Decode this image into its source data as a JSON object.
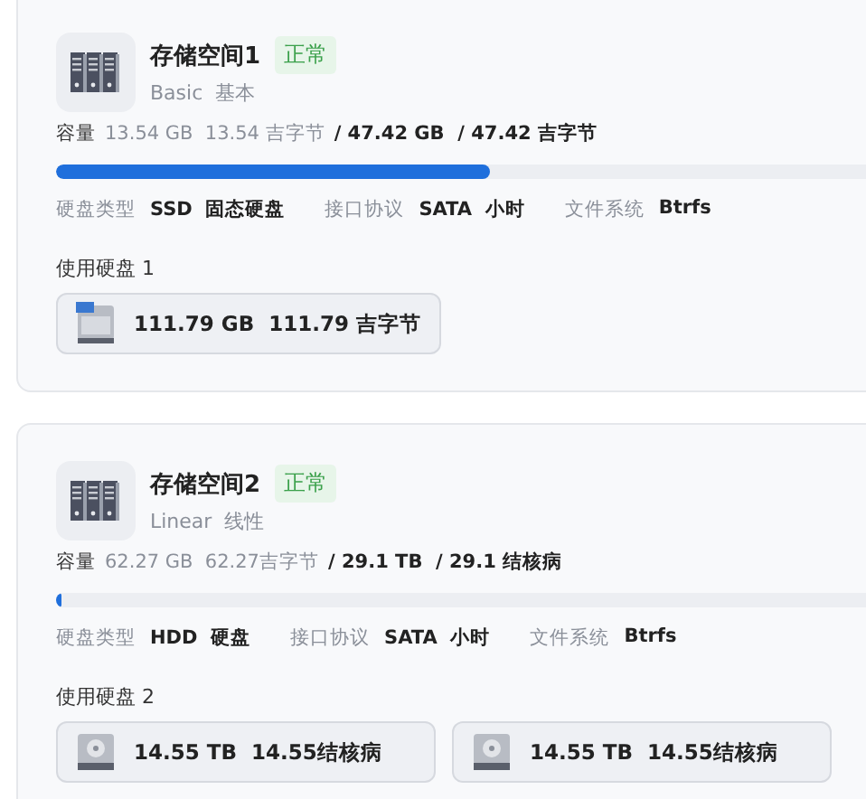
{
  "pools": [
    {
      "name": "存储空间1",
      "status": "正常",
      "raid": "Basic  基本",
      "capacity_label": "容量",
      "used": "13.54 GB  13.54 吉字节",
      "total": "/ 47.42 GB  / 47.42 吉字节",
      "level": 0.51,
      "specs": [
        {
          "label": "硬盘类型",
          "value": "SSD  固态硬盘"
        },
        {
          "label": "接口协议",
          "value": "SATA  小时"
        },
        {
          "label": "文件系统",
          "value": "Btrfs"
        }
      ],
      "disks_label": "使用硬盘 1",
      "disks": [
        {
          "kind": "ssd",
          "size": "111.79 GB  111.79 吉字节"
        }
      ]
    },
    {
      "name": "存储空间2",
      "status": "正常",
      "raid": "Linear  线性",
      "capacity_label": "容量",
      "used": "62.27 GB  62.27吉字节",
      "total": "/ 29.1 TB  / 29.1 结核病",
      "level": 0.006,
      "specs": [
        {
          "label": "硬盘类型",
          "value": "HDD  硬盘"
        },
        {
          "label": "接口协议",
          "value": "SATA  小时"
        },
        {
          "label": "文件系统",
          "value": "Btrfs"
        }
      ],
      "disks_label": "使用硬盘 2",
      "disks": [
        {
          "kind": "hdd",
          "size": "14.55 TB  14.55结核病"
        },
        {
          "kind": "hdd",
          "size": "14.55 TB  14.55结核病"
        }
      ]
    }
  ]
}
